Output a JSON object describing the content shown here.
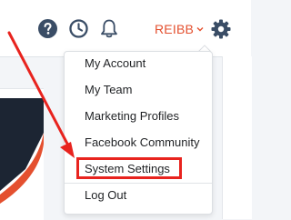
{
  "header": {
    "username": "REIBB",
    "icons": [
      "help-circle-icon",
      "clock-icon",
      "bell-icon",
      "chevron-down-icon",
      "gear-icon"
    ]
  },
  "dropdown": {
    "items": [
      {
        "label": "My Account"
      },
      {
        "label": "My Team"
      },
      {
        "label": "Marketing Profiles"
      },
      {
        "label": "Facebook Community"
      },
      {
        "label": "System Settings",
        "highlighted": true
      },
      {
        "label": "Log Out"
      }
    ]
  },
  "colors": {
    "accent": "#e4502f",
    "icon": "#3a4d66",
    "annotation": "#e8231e",
    "card_dark": "#1c2533"
  }
}
